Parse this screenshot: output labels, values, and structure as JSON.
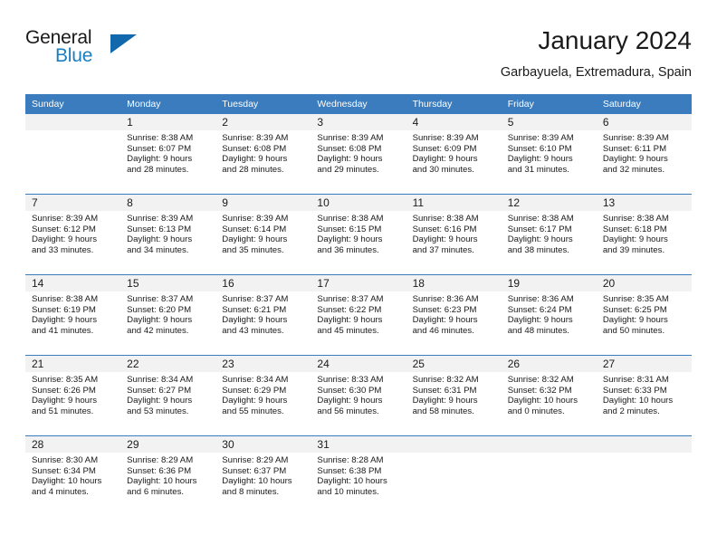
{
  "brand": {
    "line1": "General",
    "line2": "Blue",
    "triangle_color": "#1268ad",
    "blue_color": "#1a7fc1"
  },
  "header": {
    "title": "January 2024",
    "subtitle": "Garbayuela, Extremadura, Spain"
  },
  "theme": {
    "header_row_bg": "#3a7cbe",
    "daynum_band_bg": "#f2f2f2",
    "text_color": "#1a1a1a"
  },
  "weekday_headers": [
    "Sunday",
    "Monday",
    "Tuesday",
    "Wednesday",
    "Thursday",
    "Friday",
    "Saturday"
  ],
  "weeks": [
    [
      {
        "day": "",
        "sunrise": "",
        "sunset": "",
        "daylight1": "",
        "daylight2": ""
      },
      {
        "day": "1",
        "sunrise": "Sunrise: 8:38 AM",
        "sunset": "Sunset: 6:07 PM",
        "daylight1": "Daylight: 9 hours",
        "daylight2": "and 28 minutes."
      },
      {
        "day": "2",
        "sunrise": "Sunrise: 8:39 AM",
        "sunset": "Sunset: 6:08 PM",
        "daylight1": "Daylight: 9 hours",
        "daylight2": "and 28 minutes."
      },
      {
        "day": "3",
        "sunrise": "Sunrise: 8:39 AM",
        "sunset": "Sunset: 6:08 PM",
        "daylight1": "Daylight: 9 hours",
        "daylight2": "and 29 minutes."
      },
      {
        "day": "4",
        "sunrise": "Sunrise: 8:39 AM",
        "sunset": "Sunset: 6:09 PM",
        "daylight1": "Daylight: 9 hours",
        "daylight2": "and 30 minutes."
      },
      {
        "day": "5",
        "sunrise": "Sunrise: 8:39 AM",
        "sunset": "Sunset: 6:10 PM",
        "daylight1": "Daylight: 9 hours",
        "daylight2": "and 31 minutes."
      },
      {
        "day": "6",
        "sunrise": "Sunrise: 8:39 AM",
        "sunset": "Sunset: 6:11 PM",
        "daylight1": "Daylight: 9 hours",
        "daylight2": "and 32 minutes."
      }
    ],
    [
      {
        "day": "7",
        "sunrise": "Sunrise: 8:39 AM",
        "sunset": "Sunset: 6:12 PM",
        "daylight1": "Daylight: 9 hours",
        "daylight2": "and 33 minutes."
      },
      {
        "day": "8",
        "sunrise": "Sunrise: 8:39 AM",
        "sunset": "Sunset: 6:13 PM",
        "daylight1": "Daylight: 9 hours",
        "daylight2": "and 34 minutes."
      },
      {
        "day": "9",
        "sunrise": "Sunrise: 8:39 AM",
        "sunset": "Sunset: 6:14 PM",
        "daylight1": "Daylight: 9 hours",
        "daylight2": "and 35 minutes."
      },
      {
        "day": "10",
        "sunrise": "Sunrise: 8:38 AM",
        "sunset": "Sunset: 6:15 PM",
        "daylight1": "Daylight: 9 hours",
        "daylight2": "and 36 minutes."
      },
      {
        "day": "11",
        "sunrise": "Sunrise: 8:38 AM",
        "sunset": "Sunset: 6:16 PM",
        "daylight1": "Daylight: 9 hours",
        "daylight2": "and 37 minutes."
      },
      {
        "day": "12",
        "sunrise": "Sunrise: 8:38 AM",
        "sunset": "Sunset: 6:17 PM",
        "daylight1": "Daylight: 9 hours",
        "daylight2": "and 38 minutes."
      },
      {
        "day": "13",
        "sunrise": "Sunrise: 8:38 AM",
        "sunset": "Sunset: 6:18 PM",
        "daylight1": "Daylight: 9 hours",
        "daylight2": "and 39 minutes."
      }
    ],
    [
      {
        "day": "14",
        "sunrise": "Sunrise: 8:38 AM",
        "sunset": "Sunset: 6:19 PM",
        "daylight1": "Daylight: 9 hours",
        "daylight2": "and 41 minutes."
      },
      {
        "day": "15",
        "sunrise": "Sunrise: 8:37 AM",
        "sunset": "Sunset: 6:20 PM",
        "daylight1": "Daylight: 9 hours",
        "daylight2": "and 42 minutes."
      },
      {
        "day": "16",
        "sunrise": "Sunrise: 8:37 AM",
        "sunset": "Sunset: 6:21 PM",
        "daylight1": "Daylight: 9 hours",
        "daylight2": "and 43 minutes."
      },
      {
        "day": "17",
        "sunrise": "Sunrise: 8:37 AM",
        "sunset": "Sunset: 6:22 PM",
        "daylight1": "Daylight: 9 hours",
        "daylight2": "and 45 minutes."
      },
      {
        "day": "18",
        "sunrise": "Sunrise: 8:36 AM",
        "sunset": "Sunset: 6:23 PM",
        "daylight1": "Daylight: 9 hours",
        "daylight2": "and 46 minutes."
      },
      {
        "day": "19",
        "sunrise": "Sunrise: 8:36 AM",
        "sunset": "Sunset: 6:24 PM",
        "daylight1": "Daylight: 9 hours",
        "daylight2": "and 48 minutes."
      },
      {
        "day": "20",
        "sunrise": "Sunrise: 8:35 AM",
        "sunset": "Sunset: 6:25 PM",
        "daylight1": "Daylight: 9 hours",
        "daylight2": "and 50 minutes."
      }
    ],
    [
      {
        "day": "21",
        "sunrise": "Sunrise: 8:35 AM",
        "sunset": "Sunset: 6:26 PM",
        "daylight1": "Daylight: 9 hours",
        "daylight2": "and 51 minutes."
      },
      {
        "day": "22",
        "sunrise": "Sunrise: 8:34 AM",
        "sunset": "Sunset: 6:27 PM",
        "daylight1": "Daylight: 9 hours",
        "daylight2": "and 53 minutes."
      },
      {
        "day": "23",
        "sunrise": "Sunrise: 8:34 AM",
        "sunset": "Sunset: 6:29 PM",
        "daylight1": "Daylight: 9 hours",
        "daylight2": "and 55 minutes."
      },
      {
        "day": "24",
        "sunrise": "Sunrise: 8:33 AM",
        "sunset": "Sunset: 6:30 PM",
        "daylight1": "Daylight: 9 hours",
        "daylight2": "and 56 minutes."
      },
      {
        "day": "25",
        "sunrise": "Sunrise: 8:32 AM",
        "sunset": "Sunset: 6:31 PM",
        "daylight1": "Daylight: 9 hours",
        "daylight2": "and 58 minutes."
      },
      {
        "day": "26",
        "sunrise": "Sunrise: 8:32 AM",
        "sunset": "Sunset: 6:32 PM",
        "daylight1": "Daylight: 10 hours",
        "daylight2": "and 0 minutes."
      },
      {
        "day": "27",
        "sunrise": "Sunrise: 8:31 AM",
        "sunset": "Sunset: 6:33 PM",
        "daylight1": "Daylight: 10 hours",
        "daylight2": "and 2 minutes."
      }
    ],
    [
      {
        "day": "28",
        "sunrise": "Sunrise: 8:30 AM",
        "sunset": "Sunset: 6:34 PM",
        "daylight1": "Daylight: 10 hours",
        "daylight2": "and 4 minutes."
      },
      {
        "day": "29",
        "sunrise": "Sunrise: 8:29 AM",
        "sunset": "Sunset: 6:36 PM",
        "daylight1": "Daylight: 10 hours",
        "daylight2": "and 6 minutes."
      },
      {
        "day": "30",
        "sunrise": "Sunrise: 8:29 AM",
        "sunset": "Sunset: 6:37 PM",
        "daylight1": "Daylight: 10 hours",
        "daylight2": "and 8 minutes."
      },
      {
        "day": "31",
        "sunrise": "Sunrise: 8:28 AM",
        "sunset": "Sunset: 6:38 PM",
        "daylight1": "Daylight: 10 hours",
        "daylight2": "and 10 minutes."
      },
      {
        "day": "",
        "sunrise": "",
        "sunset": "",
        "daylight1": "",
        "daylight2": ""
      },
      {
        "day": "",
        "sunrise": "",
        "sunset": "",
        "daylight1": "",
        "daylight2": ""
      },
      {
        "day": "",
        "sunrise": "",
        "sunset": "",
        "daylight1": "",
        "daylight2": ""
      }
    ]
  ]
}
